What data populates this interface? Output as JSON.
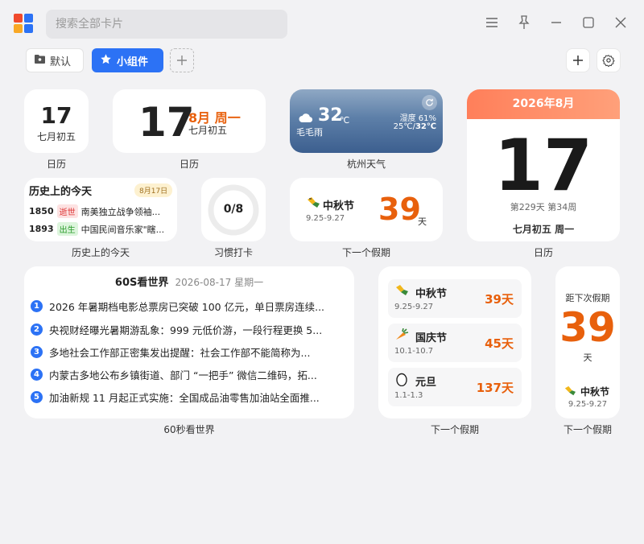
{
  "search": {
    "placeholder": "搜索全部卡片"
  },
  "tabs": {
    "default_label": "默认",
    "widget_label": "小组件"
  },
  "colors": {
    "accent": "#2c72f5",
    "orange": "#e8600c",
    "calendar_header": "#ff8a5f"
  },
  "widgets": {
    "cal_small": {
      "day": "17",
      "lunar": "七月初五",
      "caption": "日历"
    },
    "cal_medium": {
      "day": "17",
      "month_week": "8月 周一",
      "lunar": "七月初五",
      "caption": "日历"
    },
    "weather": {
      "temp": "32",
      "unit": "℃",
      "condition": "毛毛雨",
      "humidity": "湿度 61%",
      "range_low": "25℃/",
      "range_high": "32℃",
      "caption": "杭州天气",
      "icon": "cloud-rain-icon"
    },
    "cal_large": {
      "header": "2026年8月",
      "day": "17",
      "day_of_year": "第229天 第34周",
      "lunar_week": "七月初五 周一",
      "caption": "日历"
    },
    "history": {
      "title": "历史上的今天",
      "date_badge": "8月17日",
      "items": [
        {
          "year": "1850",
          "tag": "逝世",
          "text": "南美独立战争领袖..."
        },
        {
          "year": "1893",
          "tag": "出生",
          "text": "中国民间音乐家\"瞎..."
        }
      ],
      "caption": "历史上的今天"
    },
    "habit": {
      "value": "0/8",
      "caption": "习惯打卡"
    },
    "holiday_small": {
      "name": "中秋节",
      "dates": "9.25-9.27",
      "days": "39",
      "unit": "天",
      "caption": "下一个假期"
    },
    "news": {
      "title": "60S看世界",
      "date": "2026-08-17 星期一",
      "items": [
        "2026 年暑期档电影总票房已突破 100 亿元，单日票房连续...",
        "央视财经曝光暑期游乱象：999 元低价游，一段行程更换 5...",
        "多地社会工作部正密集发出提醒：社会工作部不能简称为...",
        "内蒙古多地公布乡镇街道、部门 “一把手” 微信二维码，拓...",
        "加油新规 11 月起正式实施：全国成品油零售加油站全面推..."
      ],
      "caption": "60秒看世界"
    },
    "holiday_list": {
      "items": [
        {
          "name": "中秋节",
          "dates": "9.25-9.27",
          "days": "39天",
          "icon": "mooncake-icon"
        },
        {
          "name": "国庆节",
          "dates": "10.1-10.7",
          "days": "45天",
          "icon": "carrot-icon"
        },
        {
          "name": "元旦",
          "dates": "1.1-1.3",
          "days": "137天",
          "icon": "egg-icon"
        }
      ],
      "caption": "下一个假期"
    },
    "holiday_tall": {
      "label": "距下次假期",
      "days": "39",
      "unit": "天",
      "name": "中秋节",
      "dates": "9.25-9.27",
      "caption": "下一个假期"
    }
  }
}
